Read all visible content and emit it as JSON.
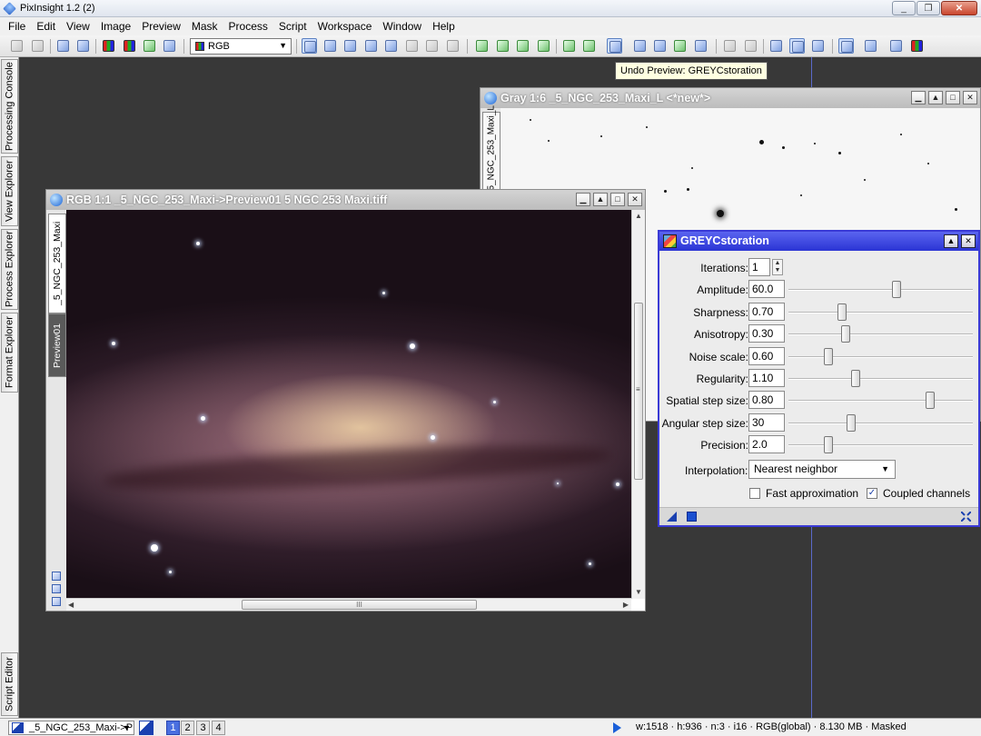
{
  "app": {
    "title": "PixInsight 1.2 (2)"
  },
  "window_controls": {
    "minimize": "_",
    "restore": "❐",
    "close": "✕"
  },
  "menu": [
    "File",
    "Edit",
    "View",
    "Image",
    "Preview",
    "Mask",
    "Process",
    "Script",
    "Workspace",
    "Window",
    "Help"
  ],
  "toolbar": {
    "channel_select": "RGB"
  },
  "tooltip": "Undo Preview: GREYCstoration",
  "left_dock": {
    "tabs": [
      "Processing Console",
      "View Explorer",
      "Process Explorer",
      "Format Explorer"
    ],
    "bottom_tab": "Script Editor"
  },
  "gray_window": {
    "title": "Gray 1:6 _5_NGC_253_Maxi_L <*new*>",
    "tab": "_5_NGC_253_Maxi_L"
  },
  "rgb_window": {
    "title": "RGB 1:1 _5_NGC_253_Maxi->Preview01 5 NGC 253 Maxi.tiff",
    "tab_main": "_5_NGC_253_Maxi",
    "tab_preview": "Preview01",
    "scroll_grip": "III",
    "vscroll_grip": "≡"
  },
  "dialog": {
    "title": "GREYCstoration",
    "params": [
      {
        "label": "Iterations:",
        "value": "1",
        "slider_pos": null
      },
      {
        "label": "Amplitude:",
        "value": "60.0",
        "slider_pos": 0.59
      },
      {
        "label": "Sharpness:",
        "value": "0.70",
        "slider_pos": 0.28
      },
      {
        "label": "Anisotropy:",
        "value": "0.30",
        "slider_pos": 0.3
      },
      {
        "label": "Noise scale:",
        "value": "0.60",
        "slider_pos": 0.2
      },
      {
        "label": "Regularity:",
        "value": "1.10",
        "slider_pos": 0.36
      },
      {
        "label": "Spatial step size:",
        "value": "0.80",
        "slider_pos": 0.78
      },
      {
        "label": "Angular step size:",
        "value": "30",
        "slider_pos": 0.33
      },
      {
        "label": "Precision:",
        "value": "2.0",
        "slider_pos": 0.2
      }
    ],
    "interpolation_label": "Interpolation:",
    "interpolation_value": "Nearest neighbor",
    "fast_approx_label": "Fast approximation",
    "fast_approx_checked": false,
    "coupled_label": "Coupled channels",
    "coupled_checked": true
  },
  "statusbar": {
    "view_select": "_5_NGC_253_Maxi->P",
    "workspaces": [
      "1",
      "2",
      "3",
      "4"
    ],
    "active_workspace": "1",
    "info": "w:1518 · h:936 · n:3 · i16 · RGB(global) · 8.130 MB · Masked"
  },
  "colors": {
    "accent": "#2a34d4",
    "workspace_bg": "#383838"
  }
}
